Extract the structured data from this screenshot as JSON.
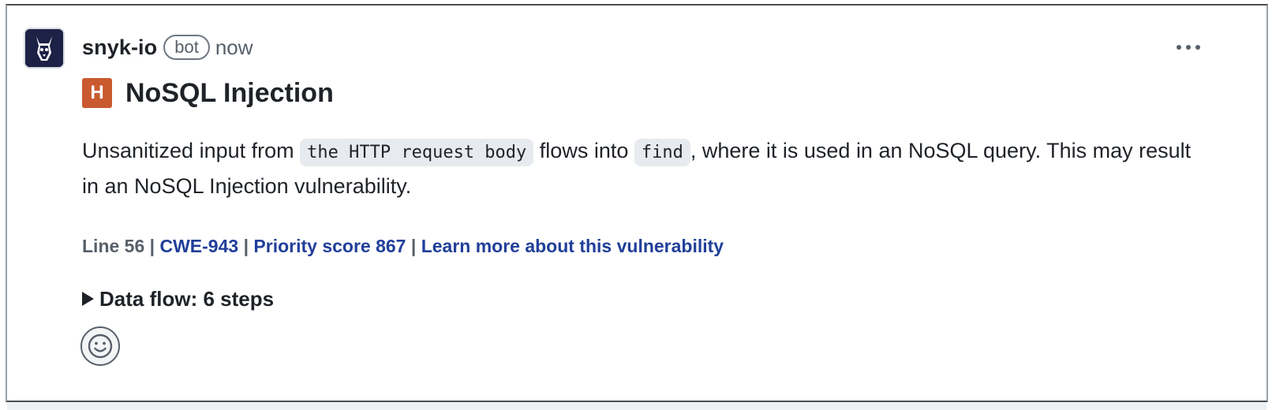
{
  "comment": {
    "author": "snyk-io",
    "author_badge": "bot",
    "timestamp": "now",
    "more_actions_icon": "kebab-horizontal-icon",
    "avatar_icon": "snyk-doberman-icon"
  },
  "issue": {
    "severity_letter": "H",
    "severity_color": "#c95a2f",
    "title": "NoSQL Injection",
    "description": {
      "part1": "Unsanitized input from ",
      "source_code": "the HTTP request body",
      "part2": " flows into ",
      "sink_code": "find",
      "part3": ", where it is used in an NoSQL query. This may result in an NoSQL Injection vulnerability."
    },
    "meta": {
      "line": "Line 56",
      "separator": " | ",
      "cwe_link": "CWE-943",
      "priority_link": "Priority score 867",
      "learn_more_link": "Learn more about this vulnerability"
    },
    "data_flow_summary": "Data flow: 6 steps"
  },
  "reactions": {
    "add_reaction_icon": "smiley-icon"
  },
  "colors": {
    "link": "#213f99",
    "muted": "#57606a",
    "text": "#1f2328",
    "code_bg": "#e7eaee"
  }
}
